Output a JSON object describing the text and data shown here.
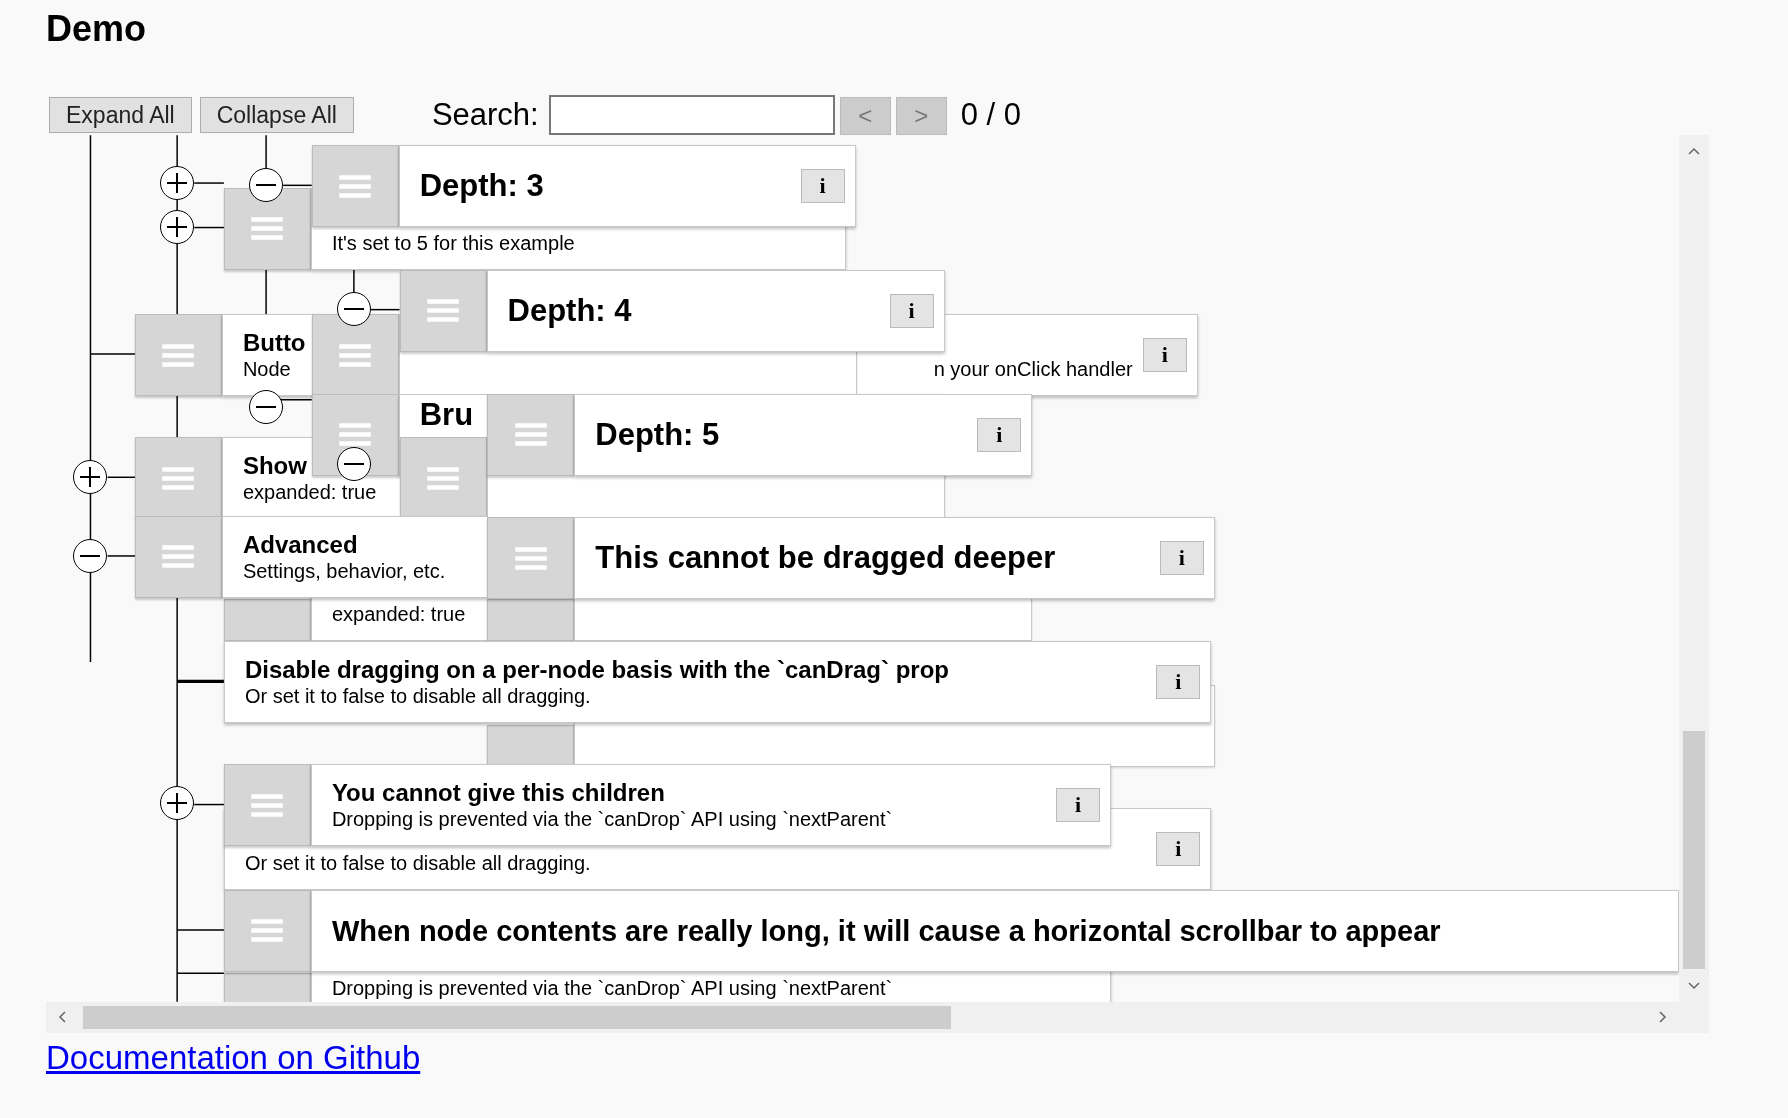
{
  "title": "Demo",
  "toolbar": {
    "buttons": [
      {
        "label": "Expand All"
      },
      {
        "label": "Collapse All"
      }
    ],
    "search": {
      "label": "Search:",
      "prev": "<",
      "next": ">",
      "count": "0 / 0"
    }
  },
  "tree": {
    "nodes": [
      {
        "kind": "node",
        "subtitle": "It's set to 5 for this example"
      },
      {
        "kind": "node",
        "title": "Butto",
        "subtitle_parts": [
          "Node",
          "n your onClick handler"
        ],
        "info": "i"
      },
      {
        "kind": "node",
        "title": "Depth: 3",
        "info": "i"
      },
      {
        "kind": "covered"
      },
      {
        "kind": "node",
        "title": "Depth: 4",
        "info": "i"
      },
      {
        "kind": "node",
        "title": "Show",
        "subtitle": "expanded: true"
      },
      {
        "kind": "node",
        "title": "Bru"
      },
      {
        "kind": "covered"
      },
      {
        "kind": "node",
        "title": "Depth: 5",
        "info": "i"
      },
      {
        "kind": "node",
        "title": "Advanced",
        "subtitle": "Settings, behavior, etc."
      },
      {
        "kind": "node",
        "subtitle": "expanded: true"
      },
      {
        "kind": "covered"
      },
      {
        "kind": "node",
        "title": "This cannot be dragged deeper",
        "info": "i"
      },
      {
        "kind": "covered"
      },
      {
        "kind": "node",
        "title": "Disable dragging on a per-node basis with the `canDrag` prop",
        "subtitle": "Or set it to false to disable all dragging.",
        "info": "i"
      },
      {
        "kind": "node",
        "title": "You cannot give this children",
        "subtitle": "Dropping is prevented via the `canDrop` API using `nextParent`",
        "info": "i"
      },
      {
        "kind": "node",
        "subtitle": "Or set it to false to disable all dragging.",
        "info": "i"
      },
      {
        "kind": "node",
        "title": "When node contents are really long, it will cause a horizontal scrollbar to appear"
      },
      {
        "kind": "node",
        "subtitle": "Dropping is prevented via the `canDrop` API using `nextParent`"
      }
    ],
    "toggles": [
      {
        "expanded": false
      },
      {
        "expanded": false
      },
      {
        "expanded": true
      },
      {
        "expanded": true
      },
      {
        "expanded": true
      },
      {
        "expanded": false
      },
      {
        "expanded": true
      },
      {
        "expanded": true
      },
      {
        "expanded": false
      }
    ]
  },
  "footer_link": "Documentation on Github"
}
